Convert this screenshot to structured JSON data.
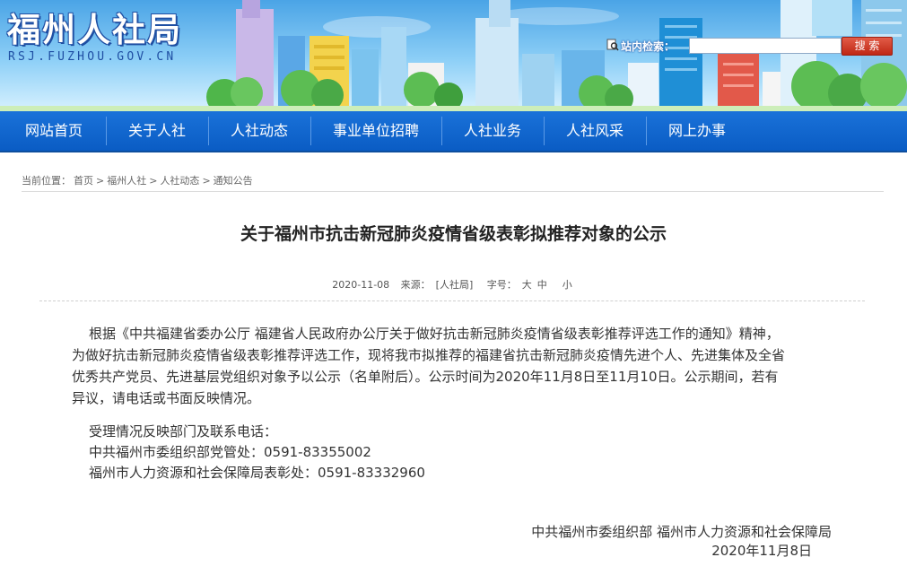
{
  "header": {
    "site_title": "福州人社局",
    "site_domain": "RSJ.FUZHOU.GOV.CN",
    "search": {
      "label": "站内检索：",
      "value": "",
      "placeholder": "",
      "button_label": "搜 索"
    }
  },
  "nav": {
    "items": [
      {
        "label": "网站首页"
      },
      {
        "label": "关于人社"
      },
      {
        "label": "人社动态"
      },
      {
        "label": "事业单位招聘"
      },
      {
        "label": "人社业务"
      },
      {
        "label": "人社风采"
      },
      {
        "label": "网上办事"
      }
    ]
  },
  "breadcrumb": {
    "prefix": "当前位置：",
    "items": [
      "首页",
      "福州人社",
      "人社动态",
      "通知公告"
    ],
    "separator": ">"
  },
  "article": {
    "title": "关于福州市抗击新冠肺炎疫情省级表彰拟推荐对象的公示",
    "date": "2020-11-08",
    "source_label": "来源：",
    "source": "[人社局]",
    "fontsize_label": "字号：",
    "fontsize_options": [
      "大",
      "中",
      "小"
    ],
    "para1_line1": "根据《中共福建省委办公厅 福建省人民政府办公厅关于做好抗击新冠肺炎疫情省级表彰推荐评选工作的通知》精神，",
    "para1_line2": "为做好抗击新冠肺炎疫情省级表彰推荐评选工作，现将我市拟推荐的福建省抗击新冠肺炎疫情先进个人、先进集体及全省",
    "para1_line3": "优秀共产党员、先进基层党组织对象予以公示（名单附后）。公示时间为2020年11月8日至11月10日。公示期间，若有",
    "para1_line4": "异议，请电话或书面反映情况。",
    "contact_heading": "受理情况反映部门及联系电话：",
    "contact_1": "中共福州市委组织部党管处：0591-83355002",
    "contact_2": "福州市人力资源和社会保障局表彰处：0591-83332960",
    "signature": "中共福州市委组织部 福州市人力资源和社会保障局",
    "sign_date": "2020年11月8日"
  },
  "colors": {
    "nav_bg": "#1a72d9",
    "search_button": "#c9301c",
    "title_text": "#222222"
  }
}
